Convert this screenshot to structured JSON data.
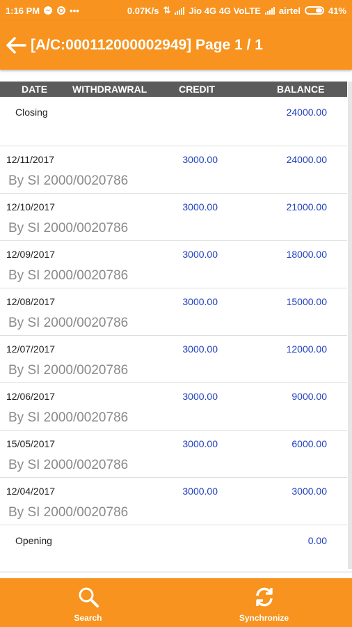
{
  "status_bar": {
    "time": "1:16 PM",
    "speed": "0.07K/s",
    "carrier1": "Jio 4G 4G VoLTE",
    "carrier2": "airtel",
    "battery": "41%"
  },
  "header": {
    "title": "[A/C:000112000002949] Page 1 / 1",
    "back_icon": "arrow-left-icon"
  },
  "table": {
    "columns": [
      "DATE",
      "WITHDRAWRAL",
      "CREDIT",
      "BALANCE"
    ],
    "closing": {
      "label": "Closing",
      "balance": "24000.00"
    },
    "rows": [
      {
        "date": "12/11/2017",
        "credit": "3000.00",
        "balance": "24000.00",
        "desc": "By SI 2000/0020786"
      },
      {
        "date": "12/10/2017",
        "credit": "3000.00",
        "balance": "21000.00",
        "desc": "By SI 2000/0020786"
      },
      {
        "date": "12/09/2017",
        "credit": "3000.00",
        "balance": "18000.00",
        "desc": "By SI 2000/0020786"
      },
      {
        "date": "12/08/2017",
        "credit": "3000.00",
        "balance": "15000.00",
        "desc": "By SI 2000/0020786"
      },
      {
        "date": "12/07/2017",
        "credit": "3000.00",
        "balance": "12000.00",
        "desc": "By SI 2000/0020786"
      },
      {
        "date": "12/06/2017",
        "credit": "3000.00",
        "balance": "9000.00",
        "desc": "By SI 2000/0020786"
      },
      {
        "date": "15/05/2017",
        "credit": "3000.00",
        "balance": "6000.00",
        "desc": "By SI 2000/0020786"
      },
      {
        "date": "12/04/2017",
        "credit": "3000.00",
        "balance": "3000.00",
        "desc": "By SI 2000/0020786"
      }
    ],
    "opening": {
      "label": "Opening",
      "balance": "0.00"
    }
  },
  "bottom_nav": {
    "search_label": "Search",
    "sync_label": "Synchronize"
  },
  "colors": {
    "accent": "#f7931e",
    "table_header": "#5b5b5b",
    "amount": "#1f3fbf",
    "description": "#8a8a8a"
  }
}
